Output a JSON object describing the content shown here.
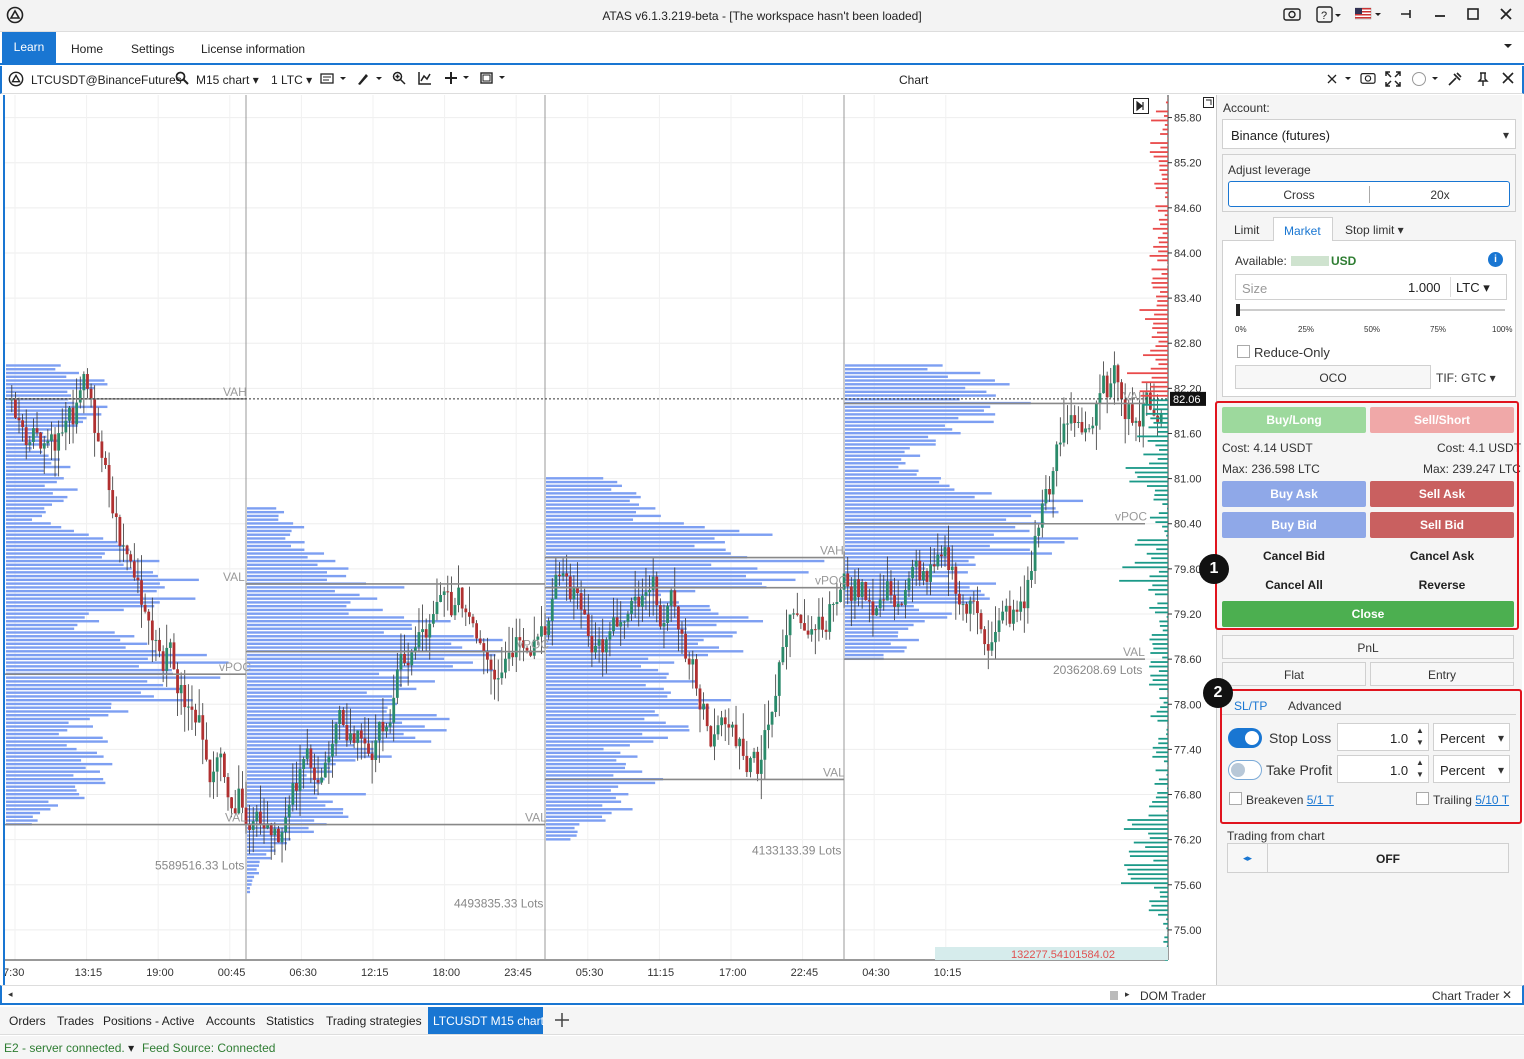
{
  "window": {
    "title": "ATAS v6.1.3.219-beta - [The workspace hasn't been loaded]"
  },
  "menu": {
    "learn": "Learn",
    "home": "Home",
    "settings": "Settings",
    "license": "License information"
  },
  "chart_header": {
    "instrument": "LTCUSDT@BinanceFutures",
    "timeframe": "M15 chart",
    "volume": "1 LTC",
    "title": "Chart"
  },
  "colors": {
    "accent": "#1976d2",
    "buy": "#9dd99d",
    "sell": "#f0a8a8",
    "ask_btn": "#8fa8e8",
    "bid_red": "#c96060",
    "close_green": "#4caf50",
    "profile": "#7d9ff2"
  },
  "chart": {
    "price_ticks": [
      "85.80",
      "85.20",
      "84.60",
      "84.00",
      "83.40",
      "82.80",
      "82.20",
      "81.60",
      "81.00",
      "80.40",
      "79.80",
      "79.20",
      "78.60",
      "78.00",
      "77.40",
      "76.80",
      "76.20",
      "75.60",
      "75.00"
    ],
    "current_price": "82.06",
    "time_ticks": [
      "7:30",
      "13:15",
      "19:00",
      "00:45",
      "06:30",
      "12:15",
      "18:00",
      "23:45",
      "05:30",
      "11:15",
      "17:00",
      "22:45",
      "04:30",
      "10:15"
    ],
    "labels": {
      "val1": "VAH",
      "val2": "vPOC",
      "val3": "VAL",
      "val4": "VAL",
      "vpoc2": "vPOC",
      "val5": "VAL",
      "vah3": "VAH",
      "vpoc3": "vPOC",
      "val6": "VAL",
      "vah4": "VAH",
      "vpoc4": "vPOC",
      "val7": "VAL"
    },
    "lots1": "5589516.33 Lots",
    "lots2": "4493835.33 Lots",
    "lots3": "4133133.39 Lots",
    "lots4": "2036208.69 Lots",
    "bottom_value": "132277.54101584.02"
  },
  "panel": {
    "account_label": "Account:",
    "account_value": "Binance (futures)",
    "leverage_label": "Adjust leverage",
    "margin_mode": "Cross",
    "leverage": "20x",
    "order_tabs": [
      "Limit",
      "Market",
      "Stop limit ▾"
    ],
    "available_label": "Available:",
    "available_currency": "USD",
    "size_placeholder": "Size",
    "size_value": "1.000",
    "size_unit": "LTC",
    "slider_marks": [
      "0%",
      "25%",
      "50%",
      "75%",
      "100%"
    ],
    "reduce_only": "Reduce-Only",
    "oco": "OCO",
    "tif_label": "TIF:",
    "tif_value": "GTC",
    "buy_long": "Buy/Long",
    "sell_short": "Sell/Short",
    "cost_buy": "Cost: 4.14 USDT",
    "cost_sell": "Cost: 4.1 USDT",
    "max_buy": "Max: 236.598 LTC",
    "max_sell": "Max: 239.247 LTC",
    "buy_ask": "Buy Ask",
    "sell_ask": "Sell Ask",
    "buy_bid": "Buy Bid",
    "sell_bid": "Sell Bid",
    "cancel_bid": "Cancel Bid",
    "cancel_ask": "Cancel Ask",
    "cancel_all": "Cancel All",
    "reverse": "Reverse",
    "close": "Close",
    "pnl": "PnL",
    "flat": "Flat",
    "entry": "Entry",
    "sltp_tab": "SL/TP",
    "advanced_tab": "Advanced",
    "stop_loss": "Stop Loss",
    "stop_loss_value": "1.0",
    "stop_loss_unit": "Percent",
    "take_profit": "Take Profit",
    "take_profit_value": "1.0",
    "take_profit_unit": "Percent",
    "breakeven": "Breakeven",
    "breakeven_link": "5/1 T",
    "trailing": "Trailing",
    "trailing_link": "5/10 T",
    "trading_from_chart": "Trading from chart",
    "trading_state": "OFF",
    "badge1": "1",
    "badge2": "2"
  },
  "bottom": {
    "dom_trader": "DOM Trader",
    "chart_trader": "Chart Trader"
  },
  "tabs": [
    "Orders",
    "Trades",
    "Positions - Active",
    "Accounts",
    "Statistics",
    "Trading strategies",
    "LTCUSDT M15 chart"
  ],
  "status": {
    "server": "E2 - server connected.",
    "feed": "Feed Source: Connected"
  }
}
